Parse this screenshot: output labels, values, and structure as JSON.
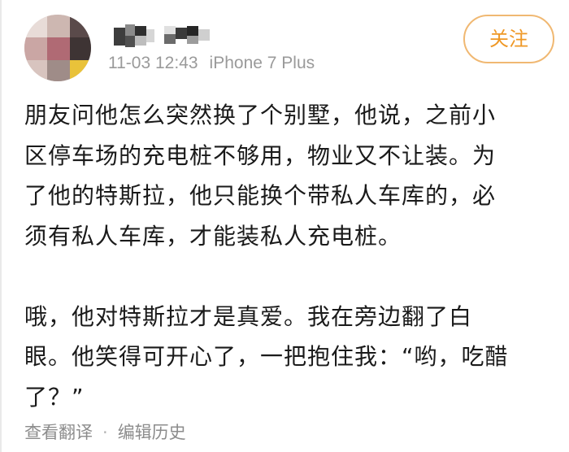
{
  "header": {
    "timestamp": "11-03 12:43",
    "device": "iPhone 7 Plus",
    "follow_label": "关注"
  },
  "post": {
    "paragraph1": [
      "朋友问他怎么突然换了个别墅，他说，之前小",
      "区停车场的充电桩不够用，物业又不让装。为",
      "了他的特斯拉，他只能换个带私人车库的，必",
      "须有私人车库，才能装私人充电桩。"
    ],
    "paragraph2": [
      "哦，他对特斯拉才是真爱。我在旁边翻了白",
      "眼。他笑得可开心了，一把抱住我：“哟，吃醋",
      "了？”"
    ]
  },
  "footer": {
    "translate_label": "查看翻译",
    "separator": "·",
    "history_label": "编辑历史"
  },
  "colors": {
    "accent": "#ef9826",
    "accent_border": "#f0b872",
    "meta_text": "#9a9a9a",
    "body_text": "#1a1a1a"
  }
}
